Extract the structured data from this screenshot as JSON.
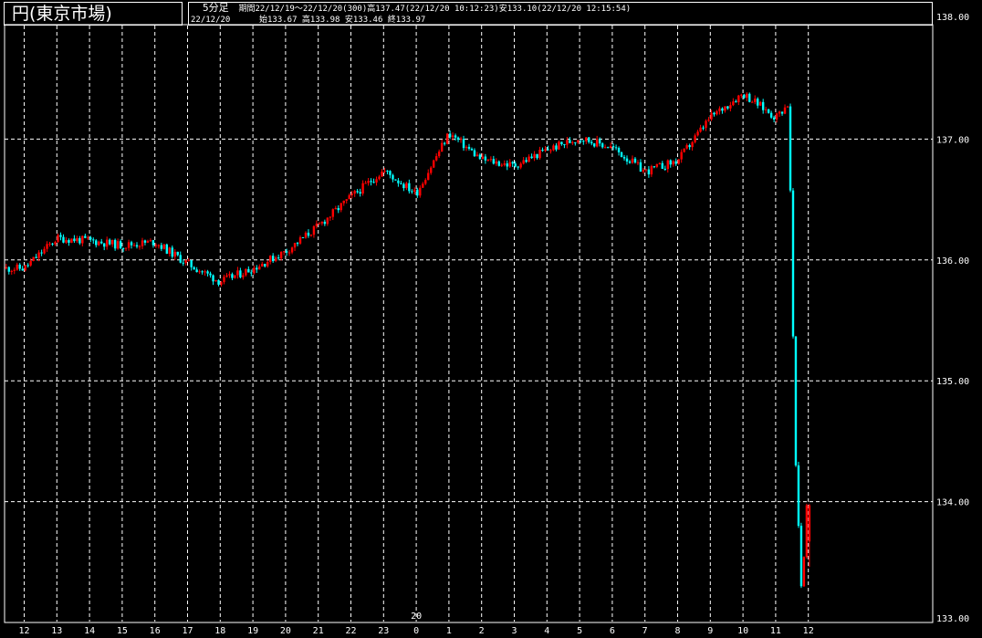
{
  "title": "円(東京市場)",
  "info": {
    "timeframe": "5分足",
    "period_line": "期間22/12/19～22/12/20(300)高137.47(22/12/20 10:12:23)安133.10(22/12/20 12:15:54)",
    "date": "22/12/20",
    "ohlc_line": "始133.67 高133.98 安133.46 終133.97"
  },
  "colors": {
    "background": "#000000",
    "up_candle": "#ff0000",
    "down_candle": "#00ffff",
    "grid": "#ffffff",
    "text": "#ffffff"
  },
  "chart_data": {
    "type": "candlestick",
    "symbol": "円(東京市場)",
    "interval": "5分足",
    "y_axis": {
      "range": [
        133.0,
        138.0
      ],
      "ticks": [
        "138.00",
        "137.00",
        "136.00",
        "135.00",
        "134.00",
        "133.00"
      ],
      "side": "right"
    },
    "x_axis": {
      "hour_labels": [
        "12",
        "13",
        "14",
        "15",
        "16",
        "17",
        "18",
        "19",
        "20",
        "21",
        "22",
        "23",
        "0",
        "1",
        "2",
        "3",
        "4",
        "5",
        "6",
        "7",
        "8",
        "9",
        "10",
        "11",
        "12"
      ],
      "day_label": "20"
    },
    "grid": true,
    "series_close_path": [
      {
        "x": 0,
        "y": 135.93
      },
      {
        "x": 1,
        "y": 136.18
      },
      {
        "x": 2,
        "y": 136.16
      },
      {
        "x": 3,
        "y": 136.12
      },
      {
        "x": 4,
        "y": 136.15
      },
      {
        "x": 5,
        "y": 135.97
      },
      {
        "x": 6,
        "y": 135.82
      },
      {
        "x": 7,
        "y": 135.93
      },
      {
        "x": 8,
        "y": 136.07
      },
      {
        "x": 9,
        "y": 136.28
      },
      {
        "x": 10,
        "y": 136.52
      },
      {
        "x": 11,
        "y": 136.74
      },
      {
        "x": 12,
        "y": 136.55
      },
      {
        "x": 13,
        "y": 137.05
      },
      {
        "x": 14,
        "y": 136.83
      },
      {
        "x": 15,
        "y": 136.78
      },
      {
        "x": 16,
        "y": 136.91
      },
      {
        "x": 17,
        "y": 137.01
      },
      {
        "x": 18,
        "y": 136.93
      },
      {
        "x": 19,
        "y": 136.73
      },
      {
        "x": 20,
        "y": 136.82
      },
      {
        "x": 21,
        "y": 137.18
      },
      {
        "x": 22,
        "y": 137.38
      },
      {
        "x": 23,
        "y": 137.18
      },
      {
        "x": 23.4,
        "y": 137.3
      },
      {
        "x": 23.6,
        "y": 134.4
      },
      {
        "x": 23.8,
        "y": 133.2
      },
      {
        "x": 23.95,
        "y": 133.97
      }
    ],
    "last_bar": {
      "date": "22/12/20",
      "open": 133.67,
      "high": 133.98,
      "low": 133.46,
      "close": 133.97
    },
    "period_high": {
      "value": 137.47,
      "time": "22/12/20 10:12:23"
    },
    "period_low": {
      "value": 133.1,
      "time": "22/12/20 12:15:54"
    }
  }
}
